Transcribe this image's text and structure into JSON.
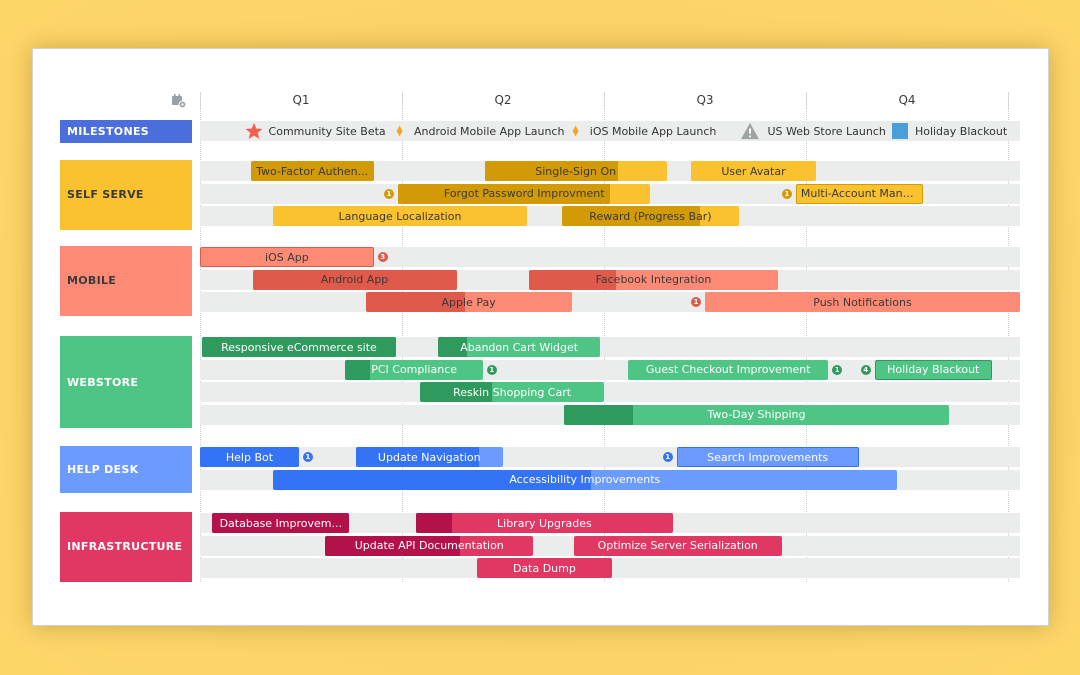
{
  "settings_icon": "calendar-gear-icon",
  "quarters": [
    "Q1",
    "Q2",
    "Q3",
    "Q4"
  ],
  "milestones": {
    "label": "MILESTONES",
    "color": "#4a6fdc",
    "items": [
      {
        "label": "Community Site Beta",
        "icon": "star-icon",
        "color": "#f2604e",
        "at": 0.27
      },
      {
        "label": "Android Mobile App Launch",
        "icon": "diamond-icon",
        "color": "#f5a623",
        "at": 1.02
      },
      {
        "label": "iOS Mobile App Launch",
        "icon": "diamond-icon",
        "color": "#f5a623",
        "at": 1.89
      },
      {
        "label": "US Web Store Launch",
        "icon": "warning-icon",
        "color": "#9ea5a1",
        "at": 2.72
      },
      {
        "label": "Holiday Blackout",
        "icon": "square-icon",
        "color": "#4a9fd8",
        "at": 3.47
      }
    ]
  },
  "lanes": [
    {
      "label": "SELF SERVE",
      "color": "#f9c22e",
      "text_color": "#3a3a3a",
      "bar_color": "#f9c22e",
      "progress_color": "#d39a07",
      "bar_text": "#3a3a3a",
      "rows": [
        [
          {
            "label": "Two-Factor Authen...",
            "start": 0.25,
            "end": 0.86,
            "progress": 1.0
          },
          {
            "label": "Single-Sign On",
            "start": 1.41,
            "end": 2.31,
            "progress": 0.73
          },
          {
            "label": "User Avatar",
            "start": 2.43,
            "end": 3.05,
            "progress": 0
          }
        ],
        [
          {
            "label": "Forgot Password Improvment",
            "start": 0.98,
            "end": 2.23,
            "progress": 0.84,
            "badge": "1",
            "badge_side": "left"
          },
          {
            "label": "Multi-Account Mana...",
            "start": 2.95,
            "end": 3.58,
            "progress": 0,
            "badge": "1",
            "badge_side": "left",
            "outlined": true
          }
        ],
        [
          {
            "label": "Language Localization",
            "start": 0.36,
            "end": 1.62,
            "progress": 0
          },
          {
            "label": "Reward (Progress Bar)",
            "start": 1.79,
            "end": 2.67,
            "progress": 0.78
          }
        ]
      ]
    },
    {
      "label": "MOBILE",
      "color": "#fd8a75",
      "text_color": "#3a3a3a",
      "bar_color": "#fd8a75",
      "progress_color": "#e05a4b",
      "bar_text": "#3a3a3a",
      "rows": [
        [
          {
            "label": "iOS App",
            "start": 0.0,
            "end": 0.86,
            "progress": 0,
            "badge": "3",
            "badge_side": "right",
            "outlined": true
          }
        ],
        [
          {
            "label": "Android App",
            "start": 0.26,
            "end": 1.27,
            "progress": 1.0
          },
          {
            "label": "Facebook Integration",
            "start": 1.63,
            "end": 2.86,
            "progress": 0.35
          }
        ],
        [
          {
            "label": "Apple Pay",
            "start": 0.82,
            "end": 1.84,
            "progress": 0.48
          },
          {
            "label": "Push Notifications",
            "start": 2.5,
            "end": 4.06,
            "progress": 0,
            "badge": "1",
            "badge_side": "left"
          }
        ]
      ]
    },
    {
      "label": "WEBSTORE",
      "color": "#4fc585",
      "text_color": "#ffffff",
      "bar_color": "#4fc585",
      "progress_color": "#2f9a5e",
      "bar_text": "#ffffff",
      "rows": [
        [
          {
            "label": "Responsive eCommerce site",
            "start": 0.01,
            "end": 0.97,
            "progress": 1.0
          },
          {
            "label": "Abandon Cart Widget",
            "start": 1.18,
            "end": 1.98,
            "progress": 0.18
          }
        ],
        [
          {
            "label": "PCI Compliance",
            "start": 0.72,
            "end": 1.4,
            "progress": 0.18,
            "badge": "1",
            "badge_side": "right"
          },
          {
            "label": "Guest Checkout Improvement",
            "start": 2.12,
            "end": 3.11,
            "progress": 0,
            "badge": "1",
            "badge_side": "right"
          },
          {
            "label": "Holiday Blackout",
            "start": 3.34,
            "end": 3.92,
            "progress": 0,
            "badge": "4",
            "badge_side": "left",
            "outlined": true
          }
        ],
        [
          {
            "label": "Reskin Shopping Cart",
            "start": 1.09,
            "end": 2.0,
            "progress": 0.39
          }
        ],
        [
          {
            "label": "Two-Day Shipping",
            "start": 1.8,
            "end": 3.71,
            "progress": 0.18
          }
        ]
      ]
    },
    {
      "label": "HELP DESK",
      "color": "#6b9bff",
      "text_color": "#ffffff",
      "bar_color": "#6b9bff",
      "progress_color": "#3573f6",
      "bar_text": "#ffffff",
      "rows": [
        [
          {
            "label": "Help Bot",
            "start": 0.0,
            "end": 0.49,
            "progress": 1.0,
            "badge": "1",
            "badge_side": "right"
          },
          {
            "label": "Update Navigation",
            "start": 0.77,
            "end": 1.5,
            "progress": 0.84
          },
          {
            "label": "Search Improvements",
            "start": 2.36,
            "end": 3.26,
            "progress": 0,
            "badge": "1",
            "badge_side": "left",
            "outlined": true
          }
        ],
        [
          {
            "label": "Accessibility Improvements",
            "start": 0.36,
            "end": 3.45,
            "progress": 0.51
          }
        ]
      ]
    },
    {
      "label": "INFRASTRUCTURE",
      "color": "#e03763",
      "text_color": "#ffffff",
      "bar_color": "#e03763",
      "progress_color": "#b3114a",
      "bar_text": "#ffffff",
      "rows": [
        [
          {
            "label": "Database Improvem...",
            "start": 0.06,
            "end": 0.74,
            "progress": 1.0
          },
          {
            "label": "Library Upgrades",
            "start": 1.07,
            "end": 2.34,
            "progress": 0.14
          }
        ],
        [
          {
            "label": "Update API Documentation",
            "start": 0.62,
            "end": 1.65,
            "progress": 0.65
          },
          {
            "label": "Optimize Server Serialization",
            "start": 1.85,
            "end": 2.88,
            "progress": 0
          }
        ],
        [
          {
            "label": "Data Dump",
            "start": 1.37,
            "end": 2.04,
            "progress": 0
          }
        ]
      ]
    }
  ]
}
